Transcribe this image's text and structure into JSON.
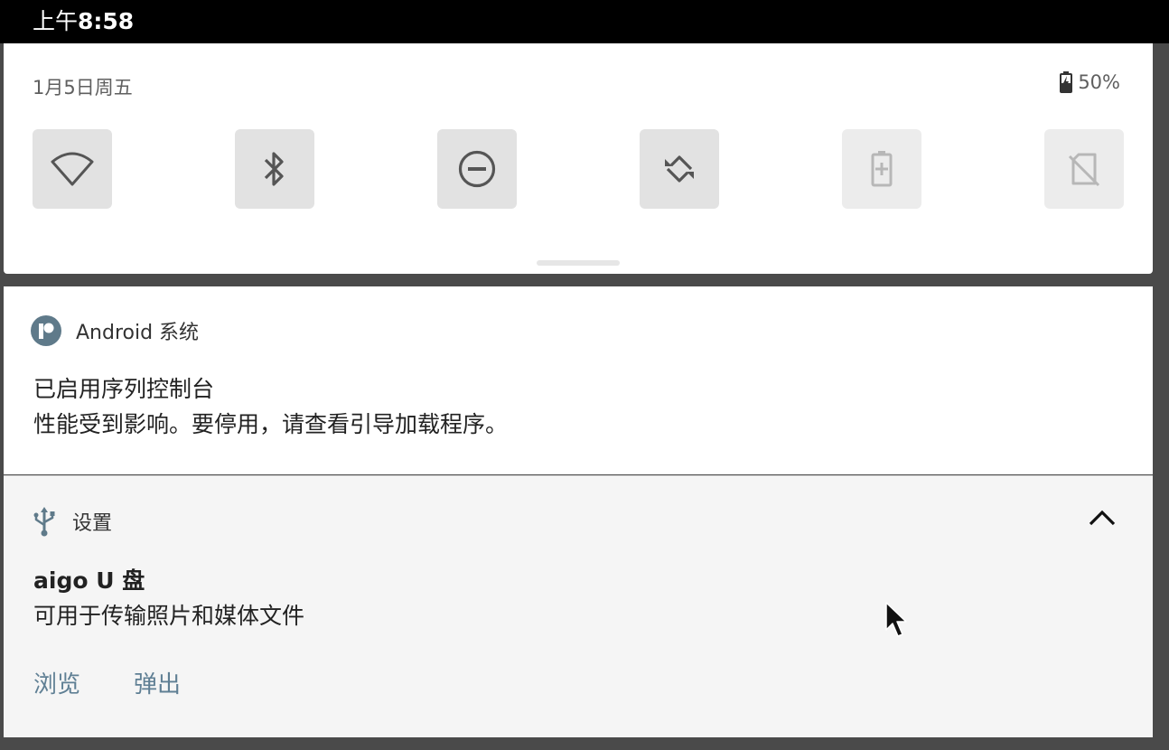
{
  "status_bar": {
    "time_prefix": "上午",
    "time": "8:58"
  },
  "quick_settings": {
    "date": "1月5日周五",
    "battery_percent": "50%",
    "tiles": [
      {
        "icon": "wifi-icon",
        "state": "off"
      },
      {
        "icon": "bluetooth-icon",
        "state": "off"
      },
      {
        "icon": "do-not-disturb-icon",
        "state": "off"
      },
      {
        "icon": "auto-rotate-icon",
        "state": "off"
      },
      {
        "icon": "battery-saver-icon",
        "state": "disabled"
      },
      {
        "icon": "no-sim-icon",
        "state": "disabled"
      }
    ]
  },
  "notifications": [
    {
      "app_icon": "android-system-icon",
      "app_name": "Android 系统",
      "title": "已启用序列控制台",
      "text": "性能受到影响。要停用，请查看引导加载程序。"
    },
    {
      "app_icon": "usb-icon",
      "app_name": "设置",
      "title": "aigo U 盘",
      "text": "可用于传输照片和媒体文件",
      "actions": [
        "浏览",
        "弹出"
      ]
    }
  ],
  "colors": {
    "accent": "#5f7f94",
    "tile_bg": "#e2e2e2",
    "status_bar": "#000000"
  }
}
